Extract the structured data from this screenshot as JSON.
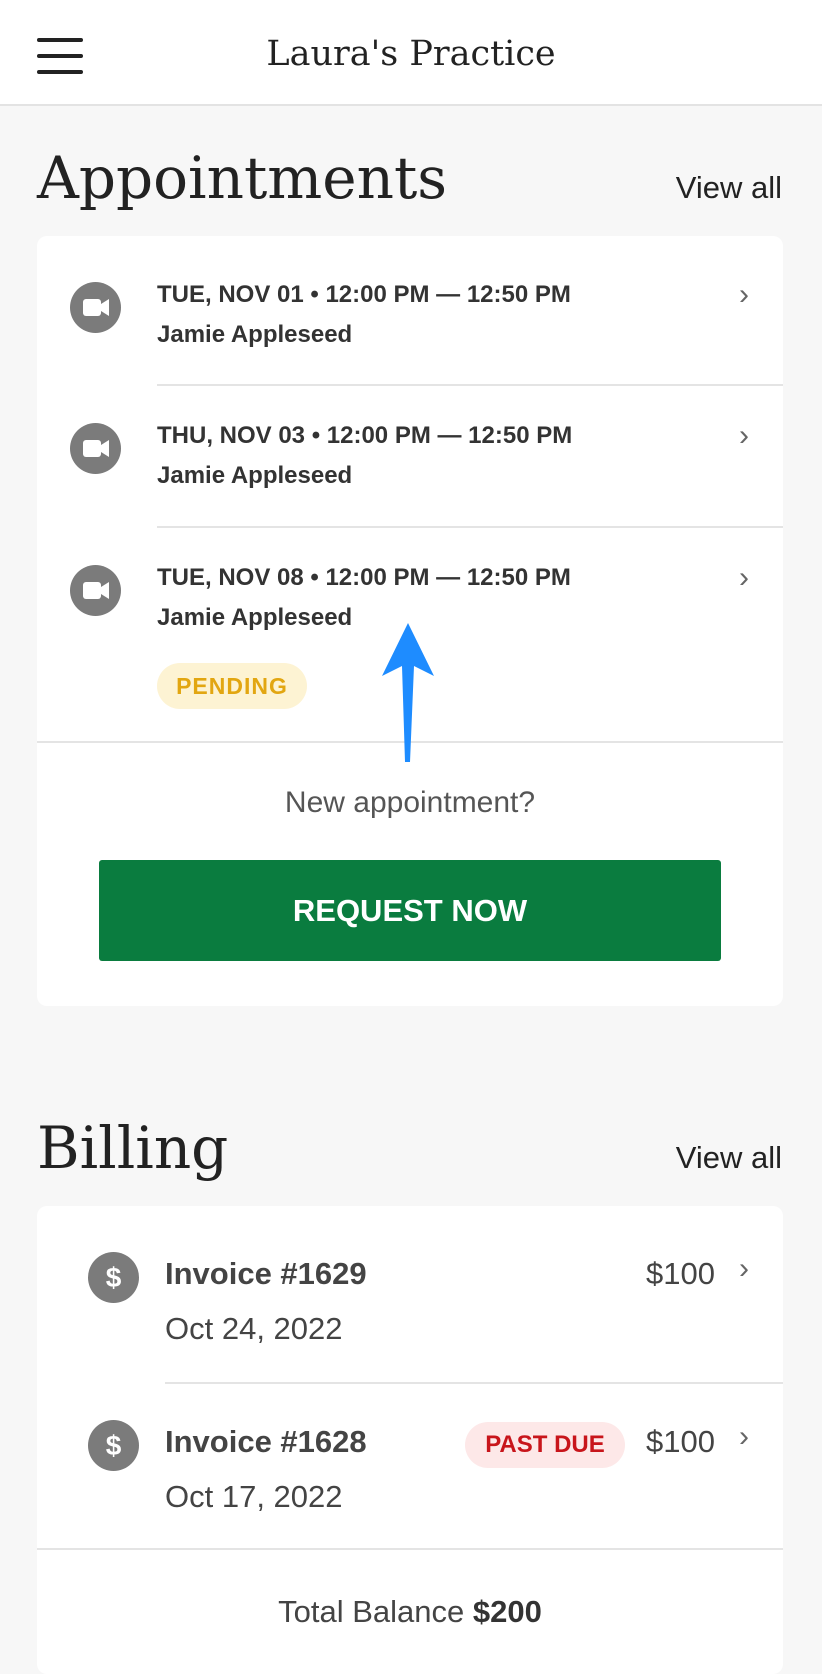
{
  "header": {
    "title": "Laura's Practice",
    "menu_icon": "hamburger-menu-icon"
  },
  "appointments": {
    "title": "Appointments",
    "view_all": "View all",
    "items": [
      {
        "date_time": "TUE, NOV 01 • 12:00 PM — 12:50 PM",
        "client": "Jamie Appleseed",
        "icon": "video-camera-icon"
      },
      {
        "date_time": "THU, NOV 03 • 12:00 PM — 12:50 PM",
        "client": "Jamie Appleseed",
        "icon": "video-camera-icon"
      },
      {
        "date_time": "TUE, NOV 08 • 12:00 PM — 12:50 PM",
        "client": "Jamie Appleseed",
        "icon": "video-camera-icon",
        "status": "PENDING"
      }
    ],
    "new_prompt": "New appointment?",
    "request_label": "REQUEST NOW"
  },
  "billing": {
    "title": "Billing",
    "view_all": "View all",
    "invoices": [
      {
        "title": "Invoice #1629",
        "date": "Oct 24, 2022",
        "amount": "$100"
      },
      {
        "title": "Invoice #1628",
        "date": "Oct 17, 2022",
        "amount": "$100",
        "status": "PAST DUE"
      }
    ],
    "total_label": "Total Balance",
    "total_value": "$200",
    "currency_symbol": "$"
  },
  "colors": {
    "accent_green": "#0a7c3f",
    "pending_text": "#e2a611",
    "pending_bg": "#fdf3d3",
    "pastdue_text": "#c8151b",
    "pastdue_bg": "#fde8e8",
    "annotation_arrow": "#1e8cff"
  },
  "chevron_glyph": "›"
}
